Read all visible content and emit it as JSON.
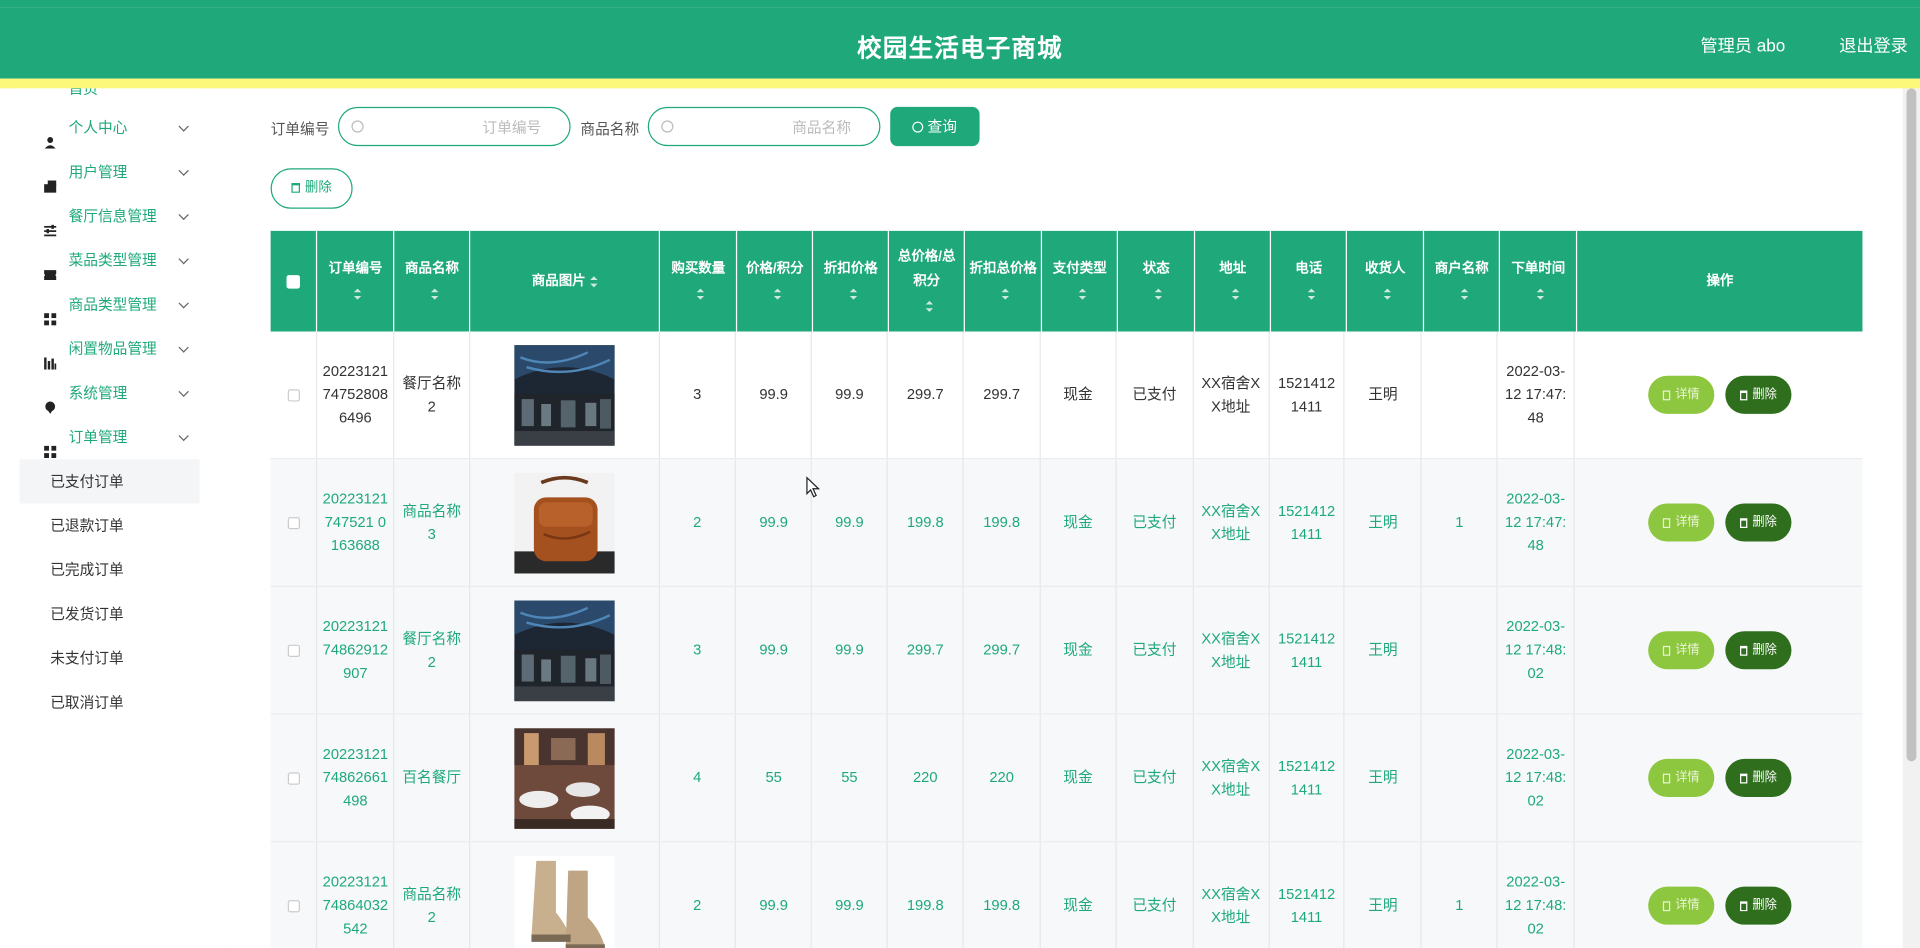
{
  "header": {
    "title": "校园生活电子商城",
    "user": "管理员 abo",
    "logout": "退出登录"
  },
  "sidebar": {
    "partial_item": "首页",
    "items": [
      {
        "label": "个人中心",
        "icon": "user-icon"
      },
      {
        "label": "用户管理",
        "icon": "users-icon"
      },
      {
        "label": "餐厅信息管理",
        "icon": "sliders-icon"
      },
      {
        "label": "菜品类型管理",
        "icon": "ticket-icon"
      },
      {
        "label": "商品类型管理",
        "icon": "grid-icon"
      },
      {
        "label": "闲置物品管理",
        "icon": "bar-chart-icon"
      },
      {
        "label": "系统管理",
        "icon": "pin-icon"
      },
      {
        "label": "订单管理",
        "icon": "grid-icon"
      }
    ],
    "sub_items": [
      "已支付订单",
      "已退款订单",
      "已完成订单",
      "已发货订单",
      "未支付订单",
      "已取消订单"
    ]
  },
  "search": {
    "order_label": "订单编号",
    "order_placeholder": "订单编号",
    "product_label": "商品名称",
    "product_placeholder": "商品名称",
    "query_button": "查询"
  },
  "toolbar": {
    "delete_label": "删除"
  },
  "table": {
    "headers": [
      "订单编号",
      "商品名称",
      "商品图片",
      "购买数量",
      "价格/积分",
      "折扣价格",
      "总价格/总积分",
      "折扣总价格",
      "支付类型",
      "状态",
      "地址",
      "电话",
      "收货人",
      "商户名称",
      "下单时间",
      "操作"
    ],
    "detail_label": "详情",
    "delete_label": "删除",
    "rows": [
      {
        "order_no": "20223121747528086496",
        "product": "餐厅名称2",
        "image": "restaurant",
        "qty": "3",
        "price": "99.9",
        "discount_price": "99.9",
        "total": "299.7",
        "discount_total": "299.7",
        "pay_type": "现金",
        "status": "已支付",
        "address": "XX宿舍XX地址",
        "phone": "15214121411",
        "receiver": "王明",
        "merchant": "",
        "time": "2022-03-12 17:47:48"
      },
      {
        "order_no": "20223121747521 0163688",
        "product": "商品名称3",
        "image": "bag",
        "qty": "2",
        "price": "99.9",
        "discount_price": "99.9",
        "total": "199.8",
        "discount_total": "199.8",
        "pay_type": "现金",
        "status": "已支付",
        "address": "XX宿舍XX地址",
        "phone": "15214121411",
        "receiver": "王明",
        "merchant": "1",
        "time": "2022-03-12 17:47:48"
      },
      {
        "order_no": "2022312174862912907",
        "product": "餐厅名称2",
        "image": "restaurant",
        "qty": "3",
        "price": "99.9",
        "discount_price": "99.9",
        "total": "299.7",
        "discount_total": "299.7",
        "pay_type": "现金",
        "status": "已支付",
        "address": "XX宿舍XX地址",
        "phone": "15214121411",
        "receiver": "王明",
        "merchant": "",
        "time": "2022-03-12 17:48:02"
      },
      {
        "order_no": "2022312174862661498",
        "product": "百名餐厅",
        "image": "dining",
        "qty": "4",
        "price": "55",
        "discount_price": "55",
        "total": "220",
        "discount_total": "220",
        "pay_type": "现金",
        "status": "已支付",
        "address": "XX宿舍XX地址",
        "phone": "15214121411",
        "receiver": "王明",
        "merchant": "",
        "time": "2022-03-12 17:48:02"
      },
      {
        "order_no": "2022312174864032542",
        "product": "商品名称2",
        "image": "boots",
        "qty": "2",
        "price": "99.9",
        "discount_price": "99.9",
        "total": "199.8",
        "discount_total": "199.8",
        "pay_type": "现金",
        "status": "已支付",
        "address": "XX宿舍XX地址",
        "phone": "15214121411",
        "receiver": "王明",
        "merchant": "1",
        "time": "2022-03-12 17:48:02"
      }
    ]
  },
  "colors": {
    "primary": "#1fa97a",
    "accent_bar": "#fbf87a",
    "detail_button": "#8dc63f",
    "delete_button": "#2f6e1c"
  }
}
